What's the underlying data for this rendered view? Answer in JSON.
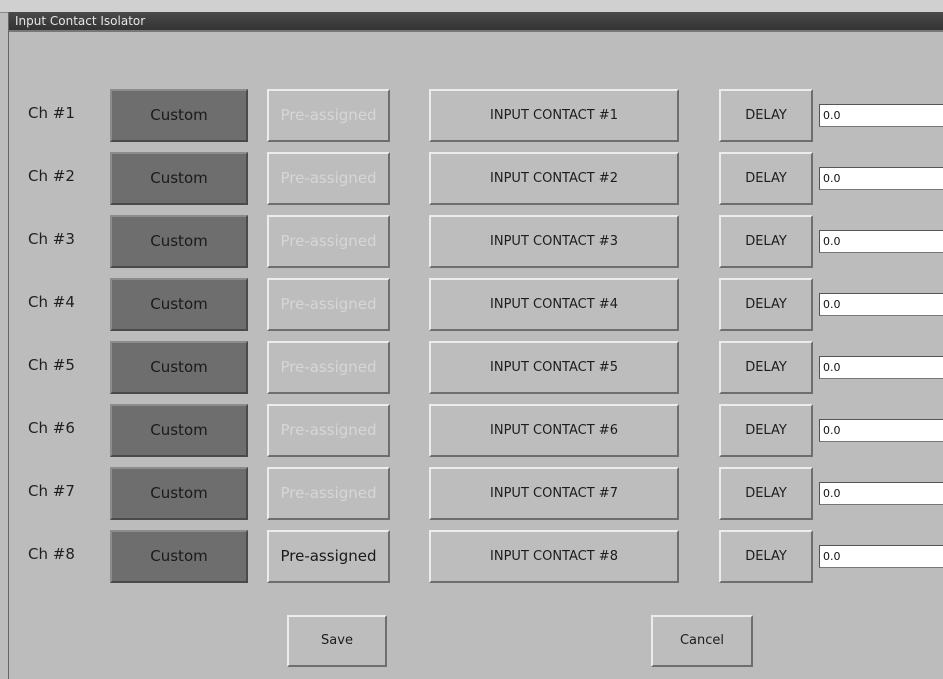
{
  "window": {
    "title": "Input Contact Isolator"
  },
  "delay_label": "DELAY",
  "channels": [
    {
      "label": "Ch #1",
      "custom": "Custom",
      "preassigned": "Pre-assigned",
      "preassigned_active": false,
      "contact": "INPUT CONTACT #1",
      "delay_value": "0.0"
    },
    {
      "label": "Ch #2",
      "custom": "Custom",
      "preassigned": "Pre-assigned",
      "preassigned_active": false,
      "contact": "INPUT CONTACT #2",
      "delay_value": "0.0"
    },
    {
      "label": "Ch #3",
      "custom": "Custom",
      "preassigned": "Pre-assigned",
      "preassigned_active": false,
      "contact": "INPUT CONTACT #3",
      "delay_value": "0.0"
    },
    {
      "label": "Ch #4",
      "custom": "Custom",
      "preassigned": "Pre-assigned",
      "preassigned_active": false,
      "contact": "INPUT CONTACT #4",
      "delay_value": "0.0"
    },
    {
      "label": "Ch #5",
      "custom": "Custom",
      "preassigned": "Pre-assigned",
      "preassigned_active": false,
      "contact": "INPUT CONTACT #5",
      "delay_value": "0.0"
    },
    {
      "label": "Ch #6",
      "custom": "Custom",
      "preassigned": "Pre-assigned",
      "preassigned_active": false,
      "contact": "INPUT CONTACT #6",
      "delay_value": "0.0"
    },
    {
      "label": "Ch #7",
      "custom": "Custom",
      "preassigned": "Pre-assigned",
      "preassigned_active": false,
      "contact": "INPUT CONTACT #7",
      "delay_value": "0.0"
    },
    {
      "label": "Ch #8",
      "custom": "Custom",
      "preassigned": "Pre-assigned",
      "preassigned_active": true,
      "contact": "INPUT CONTACT #8",
      "delay_value": "0.0"
    }
  ],
  "footer": {
    "save_label": "Save",
    "cancel_label": "Cancel"
  },
  "colors": {
    "window_bg": "#bcbcbc",
    "custom_button_bg": "#6e6e6e",
    "title_bar": "#3d3d3d"
  }
}
